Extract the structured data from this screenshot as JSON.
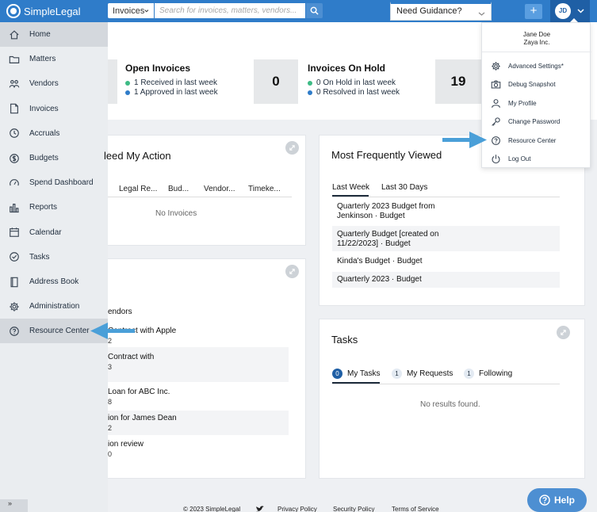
{
  "app": {
    "name": "SimpleLegal"
  },
  "search": {
    "scope": "Invoices",
    "placeholder": "Search for invoices, matters, vendors..."
  },
  "guidance": {
    "label": "Need Guidance?"
  },
  "user": {
    "initials": "JD",
    "name": "Jane Doe",
    "company": "Zaya Inc."
  },
  "sidebar": {
    "items": [
      {
        "label": "Home",
        "icon": "home-icon"
      },
      {
        "label": "Matters",
        "icon": "folder-icon"
      },
      {
        "label": "Vendors",
        "icon": "people-icon"
      },
      {
        "label": "Invoices",
        "icon": "invoice-icon"
      },
      {
        "label": "Accruals",
        "icon": "clock-icon"
      },
      {
        "label": "Budgets",
        "icon": "dollar-icon"
      },
      {
        "label": "Spend Dashboard",
        "icon": "gauge-icon"
      },
      {
        "label": "Reports",
        "icon": "bar-chart-icon"
      },
      {
        "label": "Calendar",
        "icon": "calendar-icon"
      },
      {
        "label": "Tasks",
        "icon": "check-circle-icon"
      },
      {
        "label": "Address Book",
        "icon": "book-icon"
      },
      {
        "label": "Administration",
        "icon": "gear-icon"
      },
      {
        "label": "Resource Center",
        "icon": "question-circle-icon"
      }
    ],
    "collapse_label": "»"
  },
  "stats": {
    "open_invoices": {
      "title": "Open Invoices",
      "lines": [
        "1 Received in last week",
        "1 Approved in last week"
      ],
      "colors": [
        "#3dbb85",
        "#2f7cc9"
      ]
    },
    "on_hold": {
      "title": "Invoices On Hold",
      "lines": [
        "0 On Hold in last week",
        "0 Resolved in last week"
      ],
      "value": "0"
    },
    "third_value": "19"
  },
  "action_card": {
    "title": "leed My Action",
    "columns": [
      "Legal Re...",
      "Bud...",
      "Vendor...",
      "Timeke..."
    ],
    "empty": "No Invoices"
  },
  "matters_card": {
    "rows": [
      {
        "line1": "endors",
        "line2": ""
      },
      {
        "line1": "Contract with Apple",
        "line2": "2"
      },
      {
        "line1": "Contract with",
        "line2": "3"
      },
      {
        "line1": "Loan for ABC Inc.",
        "line2": "8"
      },
      {
        "line1": "ion for James Dean",
        "line2": "2"
      },
      {
        "line1": "ion review",
        "line2": "0"
      }
    ]
  },
  "frequent": {
    "title": "Most Frequently Viewed",
    "tabs": [
      "Last Week",
      "Last 30 Days"
    ],
    "items": [
      {
        "line1": "Quarterly 2023 Budget from",
        "line2": "Jenkinson · Budget"
      },
      {
        "line1": "Quarterly Budget [created on",
        "line2": "11/22/2023] · Budget"
      },
      {
        "line1": "Kinda's Budget · Budget",
        "line2": ""
      },
      {
        "line1": "Quarterly 2023 · Budget",
        "line2": ""
      }
    ]
  },
  "tasks": {
    "title": "Tasks",
    "tabs": [
      {
        "count": "0",
        "label": "My Tasks"
      },
      {
        "count": "1",
        "label": "My Requests"
      },
      {
        "count": "1",
        "label": "Following"
      }
    ],
    "empty": "No results found."
  },
  "menu": {
    "items": [
      {
        "label": "Advanced Settings*",
        "icon": "gear-icon"
      },
      {
        "label": "Debug Snapshot",
        "icon": "camera-icon"
      },
      {
        "label": "My Profile",
        "icon": "person-icon"
      },
      {
        "label": "Change Password",
        "icon": "key-icon"
      },
      {
        "label": "Resource Center",
        "icon": "question-circle-icon"
      },
      {
        "label": "Log Out",
        "icon": "power-icon"
      }
    ]
  },
  "footer": {
    "copyright": "© 2023 SimpleLegal",
    "links": [
      "Privacy Policy",
      "Security Policy",
      "Terms of Service"
    ]
  },
  "help": {
    "label": "Help"
  },
  "colors": {
    "brand": "#2f7cc9",
    "arrow": "#4a9fd8",
    "green": "#3dbb85",
    "navy": "#1f5fa5"
  }
}
